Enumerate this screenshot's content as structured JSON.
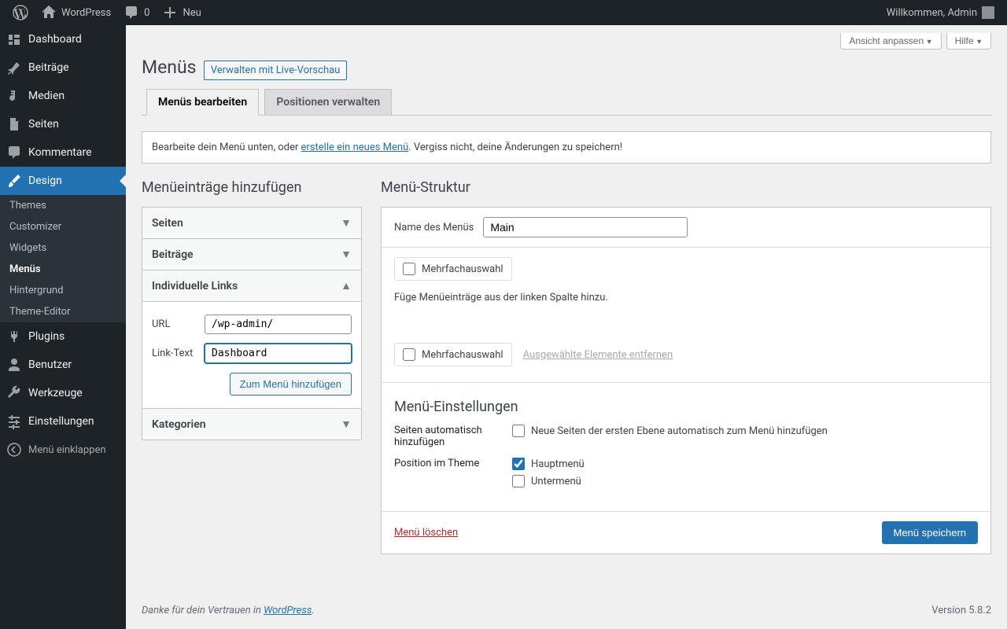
{
  "admin_bar": {
    "site_name": "WordPress",
    "comments_count": "0",
    "new_label": "Neu",
    "welcome": "Willkommen, Admin"
  },
  "sidebar": {
    "items": [
      {
        "label": "Dashboard"
      },
      {
        "label": "Beiträge"
      },
      {
        "label": "Medien"
      },
      {
        "label": "Seiten"
      },
      {
        "label": "Kommentare"
      },
      {
        "label": "Design"
      },
      {
        "label": "Plugins"
      },
      {
        "label": "Benutzer"
      },
      {
        "label": "Werkzeuge"
      },
      {
        "label": "Einstellungen"
      }
    ],
    "submenu": [
      {
        "label": "Themes"
      },
      {
        "label": "Customizer"
      },
      {
        "label": "Widgets"
      },
      {
        "label": "Menüs"
      },
      {
        "label": "Hintergrund"
      },
      {
        "label": "Theme-Editor"
      }
    ],
    "collapse": "Menü einklappen"
  },
  "screen": {
    "options_btn": "Ansicht anpassen",
    "help_btn": "Hilfe"
  },
  "page": {
    "title": "Menüs",
    "title_action": "Verwalten mit Live-Vorschau"
  },
  "tabs": {
    "edit": "Menüs bearbeiten",
    "locations": "Positionen verwalten"
  },
  "notice": {
    "text_before": "Bearbeite dein Menü unten, oder ",
    "link": "erstelle ein neues Menü",
    "text_after": ". Vergiss nicht, deine Änderungen zu speichern!"
  },
  "add": {
    "heading": "Menüeinträge hinzufügen",
    "panels": {
      "pages": "Seiten",
      "posts": "Beiträge",
      "custom": "Individuelle Links",
      "categories": "Kategorien"
    },
    "custom_form": {
      "url_label": "URL",
      "url_value": "/wp-admin/",
      "text_label": "Link-Text",
      "text_value": "Dashboard",
      "add_btn": "Zum Menü hinzufügen"
    }
  },
  "structure": {
    "heading": "Menü-Struktur",
    "name_label": "Name des Menüs",
    "name_value": "Main",
    "bulk_select_1": "Mehrfachauswahl",
    "hint": "Füge Menüeinträge aus der linken Spalte hinzu.",
    "bulk_select_2": "Mehrfachauswahl",
    "remove_selected": "Ausgewählte Elemente entfernen",
    "settings_heading": "Menü-Einstellungen",
    "auto_add_label": "Seiten automatisch hinzufügen",
    "auto_add_option": "Neue Seiten der ersten Ebene automatisch zum Menü hinzufügen",
    "location_label": "Position im Theme",
    "location_options": [
      "Hauptmenü",
      "Untermenü"
    ],
    "delete": "Menü löschen",
    "save": "Menü speichern"
  },
  "footer": {
    "thanks_before": "Danke für dein Vertrauen in ",
    "thanks_link": "WordPress",
    "thanks_after": ".",
    "version": "Version 5.8.2"
  }
}
